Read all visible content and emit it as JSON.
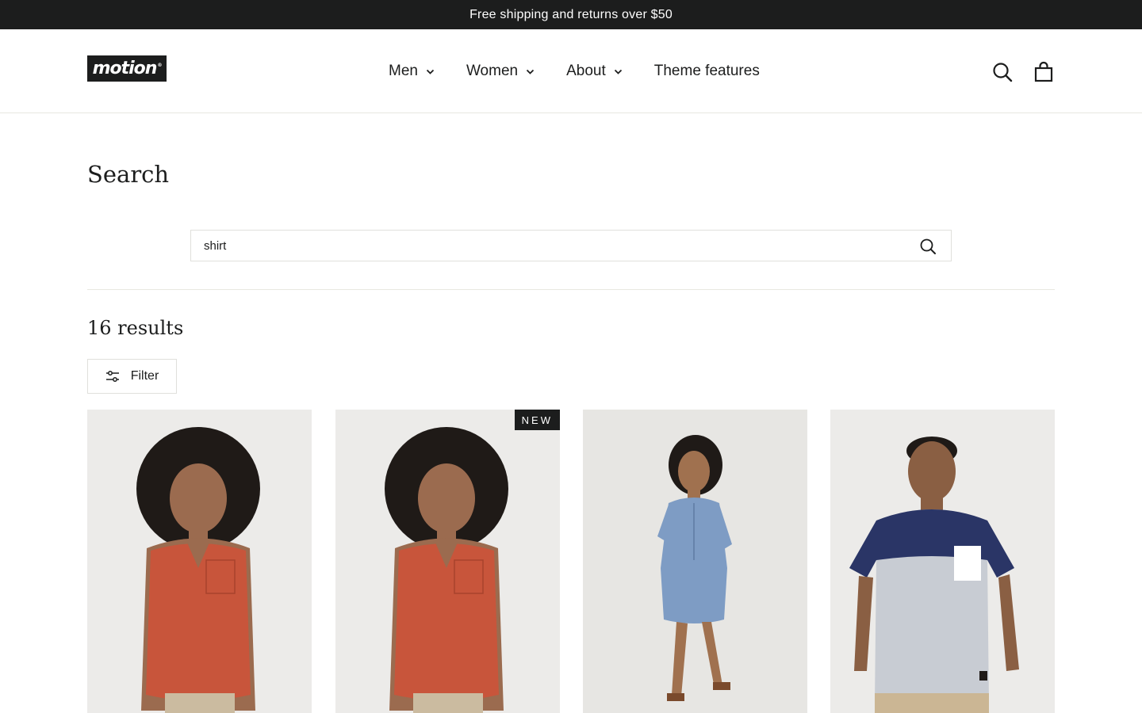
{
  "announcement": {
    "text": "Free shipping and returns over $50"
  },
  "header": {
    "logo_text": "motion",
    "logo_mark": "®",
    "nav": [
      {
        "label": "Men",
        "has_dropdown": true
      },
      {
        "label": "Women",
        "has_dropdown": true
      },
      {
        "label": "About",
        "has_dropdown": true
      },
      {
        "label": "Theme features",
        "has_dropdown": false
      }
    ],
    "icons": [
      "search-icon",
      "cart-icon"
    ]
  },
  "page": {
    "title": "Search",
    "search": {
      "value": "shirt",
      "placeholder": ""
    },
    "results_count": "16 results",
    "filter_label": "Filter"
  },
  "products": [
    {
      "image": "woman in sleeveless rust henley top",
      "badge": ""
    },
    {
      "image": "woman in sleeveless rust henley top",
      "badge": "NEW"
    },
    {
      "image": "woman in blue chambray shirt dress",
      "badge": ""
    },
    {
      "image": "man in navy and grey colorblock pocket tee",
      "badge": ""
    }
  ],
  "colors": {
    "primary_text": "#1c1d1d",
    "announcement_bg": "#1c1d1d",
    "border": "#e8e8e1",
    "photo_bg": "#ecebe9",
    "rust": "#c8553b",
    "chambray": "#7e9cc4",
    "navy": "#2a3566"
  }
}
